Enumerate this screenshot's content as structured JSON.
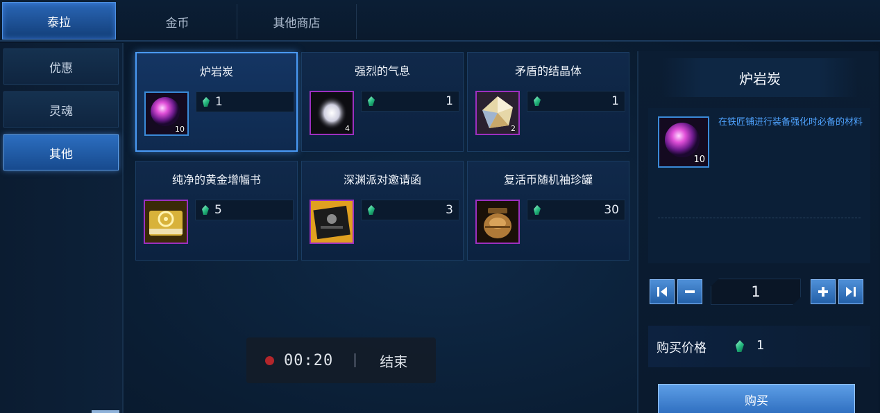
{
  "tabs": [
    {
      "label": "泰拉",
      "active": true
    },
    {
      "label": "金币",
      "active": false
    },
    {
      "label": "其他商店",
      "active": false
    }
  ],
  "sidebar": {
    "items": [
      {
        "label": "优惠",
        "active": false
      },
      {
        "label": "灵魂",
        "active": false
      },
      {
        "label": "其他",
        "active": true
      }
    ]
  },
  "items": [
    {
      "name": "炉岩炭",
      "price": "1",
      "qty": "10",
      "icon": "pink-orb-icon",
      "selected": true
    },
    {
      "name": "强烈的气息",
      "price": "1",
      "qty": "4",
      "icon": "white-aura-icon",
      "selected": false
    },
    {
      "name": "矛盾的结晶体",
      "price": "1",
      "qty": "2",
      "icon": "crystal-icon",
      "selected": false
    },
    {
      "name": "纯净的黄金增幅书",
      "price": "5",
      "qty": "",
      "icon": "golden-book-icon",
      "selected": false
    },
    {
      "name": "深渊派对邀请函",
      "price": "3",
      "qty": "",
      "icon": "invitation-letter-icon",
      "selected": false
    },
    {
      "name": "复活币随机袖珍罐",
      "price": "30",
      "qty": "",
      "icon": "coin-jar-icon",
      "selected": false
    }
  ],
  "detail": {
    "title": "炉岩炭",
    "qty_badge": "10",
    "description": "在铁匠铺进行装备强化时必备的材料",
    "quantity": "1",
    "price_label": "购买价格",
    "price": "1",
    "buy_label": "购买"
  },
  "recording": {
    "time": "00:20",
    "end_label": "结束"
  }
}
